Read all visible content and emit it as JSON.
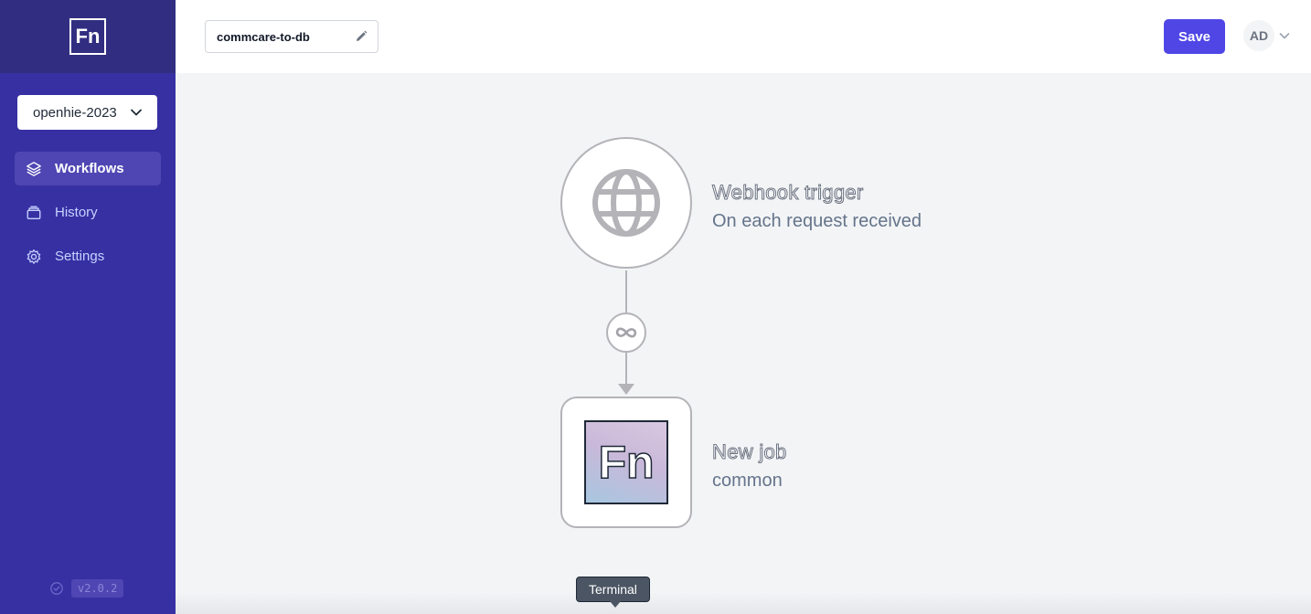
{
  "sidebar": {
    "logo_text": "Fn",
    "project": "openhie-2023",
    "items": [
      {
        "label": "Workflows",
        "icon": "layers-icon",
        "active": true
      },
      {
        "label": "History",
        "icon": "archive-icon",
        "active": false
      },
      {
        "label": "Settings",
        "icon": "gear-icon",
        "active": false
      }
    ],
    "version": "v2.0.2"
  },
  "header": {
    "workflow_name": "commcare-to-db",
    "save_label": "Save",
    "user_initials": "AD"
  },
  "canvas": {
    "trigger": {
      "title": "Webhook trigger",
      "subtitle": "On each request received",
      "icon": "globe-icon"
    },
    "edge": {
      "icon": "infinity-icon"
    },
    "job": {
      "title": "New job",
      "subtitle": "common",
      "logo_text": "Fn"
    },
    "tooltip": "Terminal"
  },
  "colors": {
    "sidebar": "#3730a3",
    "sidebar_header": "#312e81",
    "accent": "#4f46e5",
    "node_border": "#b3b3b8"
  }
}
